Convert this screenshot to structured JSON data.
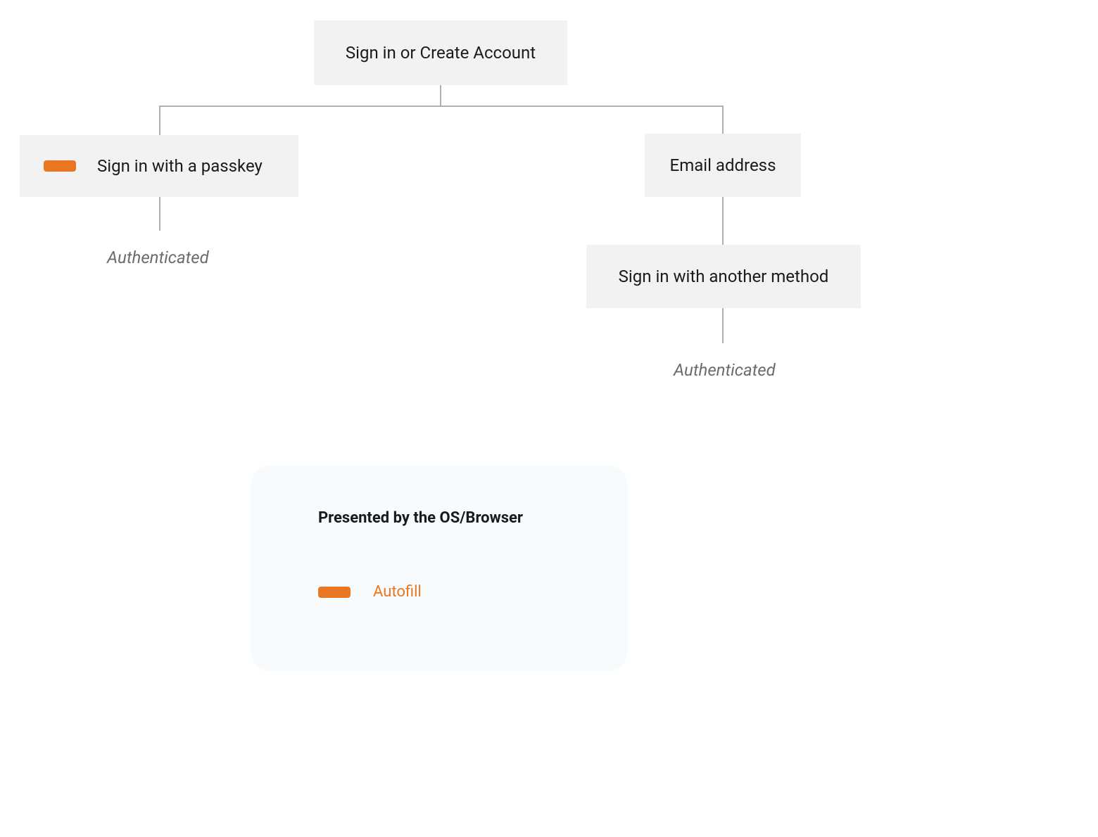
{
  "diagram": {
    "root": {
      "label": "Sign in or Create Account"
    },
    "left": {
      "passkey": {
        "label": "Sign in with a passkey"
      },
      "authenticated": "Authenticated"
    },
    "right": {
      "email": {
        "label": "Email address"
      },
      "another": {
        "label": "Sign in with another method"
      },
      "authenticated": "Authenticated"
    }
  },
  "legend": {
    "title": "Presented by the OS/Browser",
    "items": [
      {
        "label": "Autofill"
      }
    ]
  },
  "colors": {
    "accent": "#e97721",
    "node_bg": "#f2f2f2",
    "panel_bg": "#f8fbfd",
    "line": "#b0b0b0",
    "text_muted": "#6b6b6b"
  }
}
